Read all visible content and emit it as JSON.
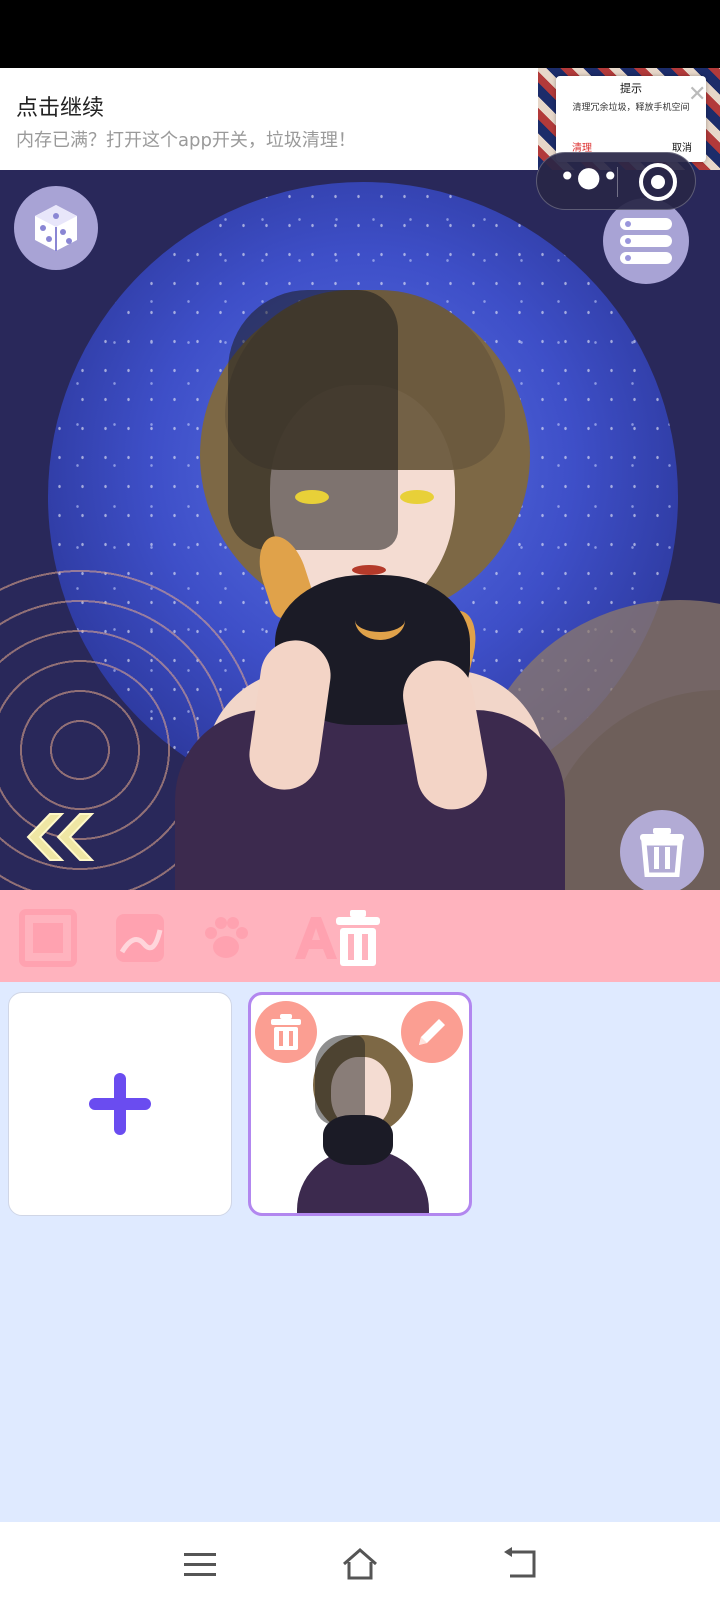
{
  "ad": {
    "title": "点击继续",
    "subtitle": "内存已满？打开这个app开关，垃圾清理！",
    "dialog_title": "提示",
    "dialog_message": "清理冗余垃圾，释放手机空间",
    "dialog_confirm": "清理",
    "dialog_cancel": "取消",
    "close_glyph": "✕"
  },
  "capsule": {
    "more_glyph": "•●•"
  },
  "canvas": {
    "buttons": [
      "dice-icon",
      "list-menu-icon",
      "trash-icon",
      "double-chevron-left-icon"
    ]
  },
  "tabs": [
    {
      "icon": "frame-icon",
      "active": false
    },
    {
      "icon": "background-icon",
      "active": false
    },
    {
      "icon": "paw-icon",
      "active": false
    },
    {
      "icon": "text-icon",
      "label": "A",
      "active": false
    },
    {
      "icon": "trash-icon",
      "active": true
    }
  ],
  "gallery": {
    "add_glyph": "+",
    "saved_count": 1
  },
  "colors": {
    "accent_purple": "#6a4cf0",
    "tab_bar": "#ffb3be",
    "card_border": "#b287ef",
    "mini_button": "#fb9e92",
    "background": "#dfeaff"
  },
  "nav": [
    "menu-icon",
    "home-icon",
    "back-icon"
  ]
}
